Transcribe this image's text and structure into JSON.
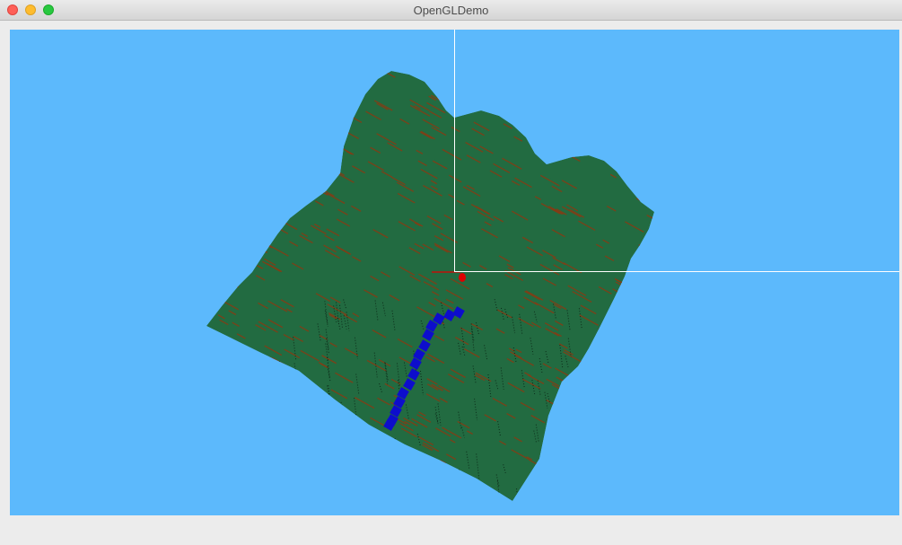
{
  "window": {
    "title": "OpenGLDemo",
    "controls": [
      "close",
      "minimize",
      "zoom"
    ]
  },
  "scene": {
    "sky_color": "#5cb9fc",
    "terrain_color": "#226b41",
    "ridge_color": "#8a3a13",
    "river_color": "#0d0dcc",
    "marker_color": "#dd0000",
    "crosshair_color": "#ffffff"
  }
}
